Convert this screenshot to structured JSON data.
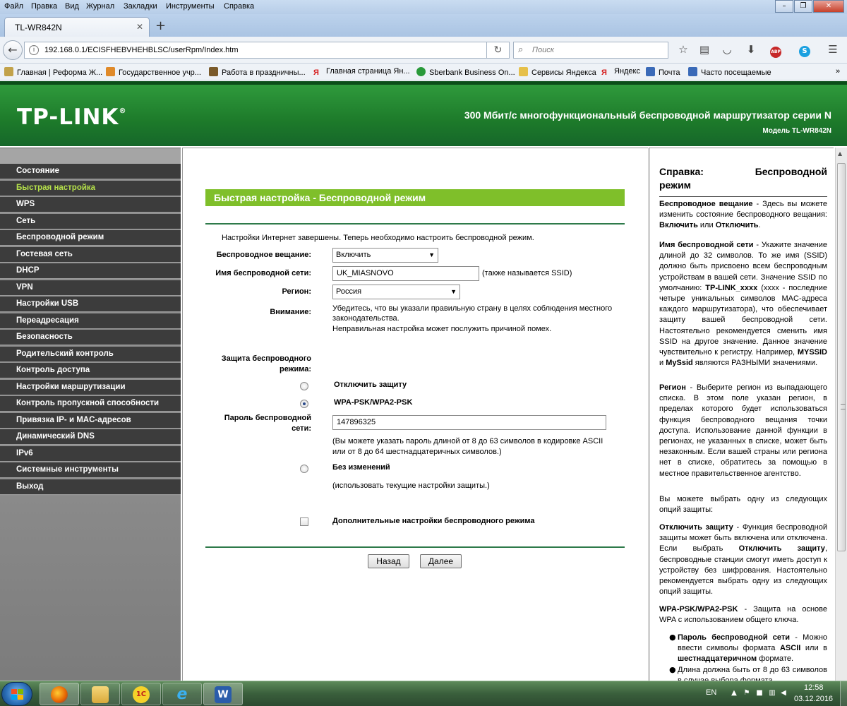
{
  "browser": {
    "menu": [
      "Файл",
      "Правка",
      "Вид",
      "Журнал",
      "Закладки",
      "Инструменты",
      "Справка"
    ],
    "tab_title": "TL-WR842N",
    "url": "192.168.0.1/ECISFHEBVHEHBLSC/userRpm/Index.htm",
    "search_placeholder": "Поиск",
    "bookmarks": [
      {
        "label": "Главная | Реформа Ж...",
        "color": "#c2a24a"
      },
      {
        "label": "Государственное учр...",
        "color": "#e08a2a"
      },
      {
        "label": "Работа в праздничны...",
        "color": "#7a5a2a"
      },
      {
        "label": "Главная страница Ян...",
        "color": "#d62222"
      },
      {
        "label": "Sberbank Business On...",
        "color": "#2a9a3a"
      },
      {
        "label": "Сервисы Яндекса",
        "color": "#e6c04a"
      },
      {
        "label": "Яндекс",
        "color": "#d62222"
      },
      {
        "label": "Почта",
        "color": "#3a6ab8"
      },
      {
        "label": "Часто посещаемые",
        "color": "#3a6ab8"
      }
    ]
  },
  "header": {
    "logo": "TP-LINK",
    "title": "300 Мбит/с многофункциональный беспроводной маршрутизатор серии N",
    "model": "Модель TL-WR842N"
  },
  "sidebar": {
    "items": [
      {
        "label": "Состояние",
        "active": false
      },
      {
        "label": "Быстрая настройка",
        "active": true
      },
      {
        "label": "WPS",
        "active": false
      },
      {
        "label": "Сеть",
        "active": false
      },
      {
        "label": "Беспроводной режим",
        "active": false
      },
      {
        "label": "Гостевая сеть",
        "active": false
      },
      {
        "label": "DHCP",
        "active": false
      },
      {
        "label": "VPN",
        "active": false
      },
      {
        "label": "Настройки USB",
        "active": false
      },
      {
        "label": "Переадресация",
        "active": false
      },
      {
        "label": "Безопасность",
        "active": false
      },
      {
        "label": "Родительский контроль",
        "active": false
      },
      {
        "label": "Контроль доступа",
        "active": false
      },
      {
        "label": "Настройки маршрутизации",
        "active": false
      },
      {
        "label": "Контроль пропускной способности",
        "active": false
      },
      {
        "label": "Привязка IP- и MAC-адресов",
        "active": false
      },
      {
        "label": "Динамический DNS",
        "active": false
      },
      {
        "label": "IPv6",
        "active": false
      },
      {
        "label": "Системные инструменты",
        "active": false
      },
      {
        "label": "Выход",
        "active": false
      }
    ]
  },
  "main": {
    "section_title": "Быстрая настройка - Беспроводной режим",
    "intro": "Настройки Интернет завершены. Теперь необходимо настроить беспроводной режим.",
    "broadcast_label": "Беспроводное вещание:",
    "broadcast_value": "Включить",
    "ssid_label": "Имя беспроводной сети:",
    "ssid_value": "UK_MIASNOVO",
    "ssid_note": "(также называется SSID)",
    "region_label": "Регион:",
    "region_value": "Россия",
    "warning_label": "Внимание:",
    "warning_line1": "Убедитесь, что вы указали правильную страну в целях соблюдения местного",
    "warning_line2": "законодательства.",
    "warning_line3": "Неправильная настройка может послужить причиной помех.",
    "security_label_1": "Защита беспроводного",
    "security_label_2": "режима:",
    "opt_disable": "Отключить защиту",
    "opt_wpa": "WPA-PSK/WPA2-PSK",
    "password_label_1": "Пароль беспроводной",
    "password_label_2": "сети:",
    "password_value": "147896325",
    "password_note_1": "(Вы можете указать пароль длиной от 8 до 63 символов в кодировке ASCII",
    "password_note_2": "или от 8 до 64 шестнадцатеричных символов.)",
    "opt_nochange": "Без изменений",
    "nochange_note": "(использовать текущие настройки защиты.)",
    "advanced_label": "Дополнительные настройки беспроводного режима",
    "back_button": "Назад",
    "next_button": "Далее"
  },
  "help": {
    "title_left": "Справка:",
    "title_right": "Беспроводной",
    "title_line2": "режим"
  },
  "taskbar": {
    "lang": "EN",
    "time": "12:58",
    "date": "03.12.2016"
  }
}
